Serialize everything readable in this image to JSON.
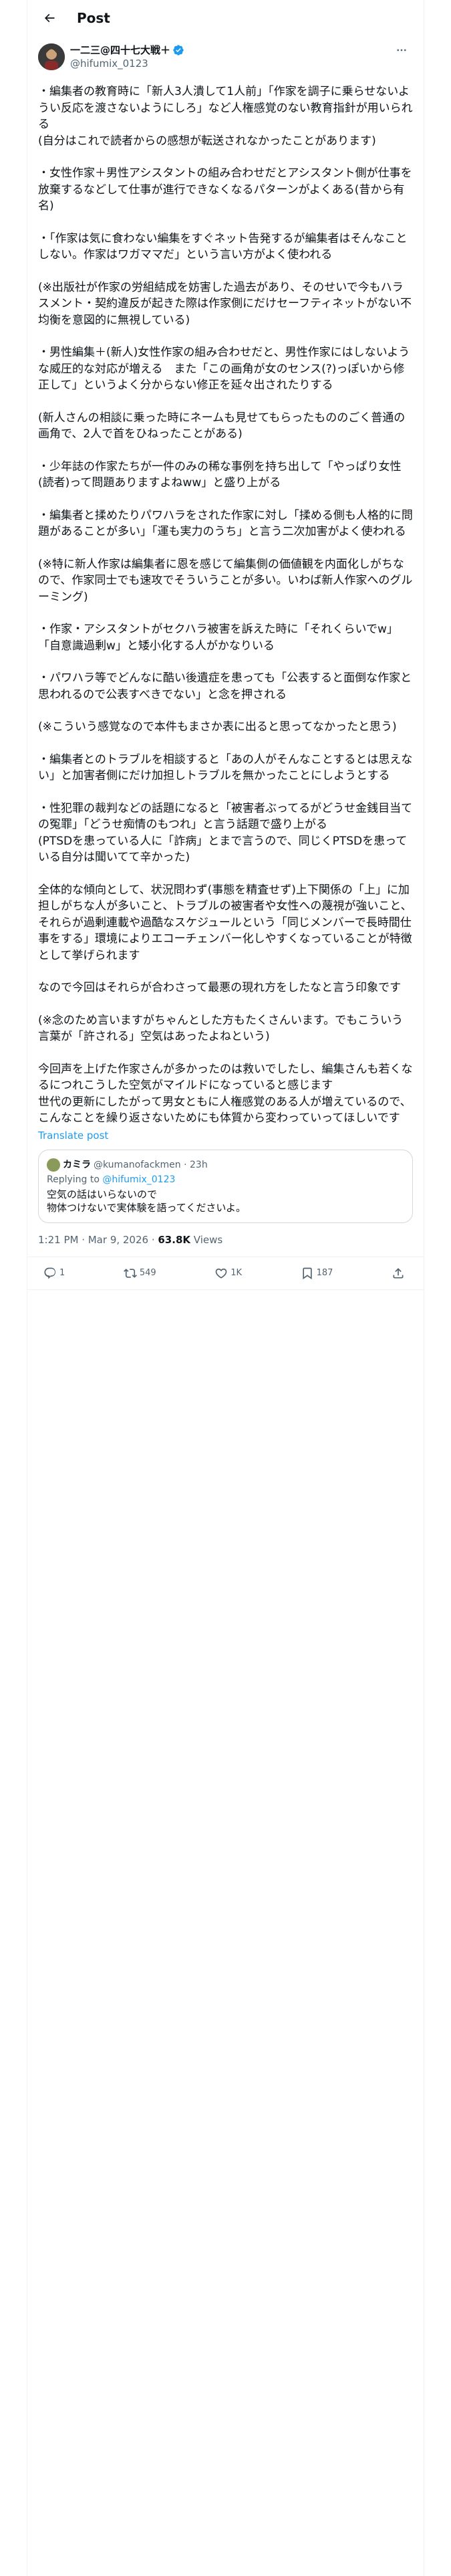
{
  "header": {
    "title": "Post"
  },
  "author": {
    "display_name": "一二三@四十七大戦＋",
    "handle": "@hifumix_0123"
  },
  "post": {
    "paragraphs": [
      "・編集者の教育時に「新人3人潰して1人前」「作家を調子に乗らせないようい反応を渡さないようにしろ」など人権感覚のない教育指針が用いられる\n(自分はこれで読者からの感想が転送されなかったことがあります)",
      "・女性作家＋男性アシスタントの組み合わせだとアシスタント側が仕事を放棄するなどして仕事が進行できなくなるパターンがよくある(昔から有名)",
      "・「作家は気に食わない編集をすぐネット告発するが編集者はそんなことしない。作家はワガママだ」という言い方がよく使われる",
      "(※出版社が作家の労組結成を妨害した過去があり、そのせいで今もハラスメント・契約違反が起きた際は作家側にだけセーフティネットがない不均衡を意図的に無視している)",
      "・男性編集＋(新人)女性作家の組み合わせだと、男性作家にはしないような威圧的な対応が増える　また「この画角が女のセンス(?)っぽいから修正して」というよく分からない修正を延々出されたりする",
      "(新人さんの相談に乗った時にネームも見せてもらったもののごく普通の画角で、2人で首をひねったことがある)",
      "・少年誌の作家たちが一件のみの稀な事例を持ち出して「やっぱり女性(読者)って問題ありますよねww」と盛り上がる",
      "・編集者と揉めたりパワハラをされた作家に対し「揉める側も人格的に問題があることが多い」「運も実力のうち」と言う二次加害がよく使われる",
      "(※特に新人作家は編集者に恩を感じて編集側の価値観を内面化しがちなので、作家同士でも速攻でそういうことが多い。いわば新人作家へのグルーミング)",
      "・作家・アシスタントがセクハラ被害を訴えた時に「それくらいでw」「自意識過剰w」と矮小化する人がかなりいる",
      "・パワハラ等でどんなに酷い後遺症を患っても「公表すると面倒な作家と思われるので公表すべきでない」と念を押される",
      "(※こういう感覚なので本件もまさか表に出ると思ってなかったと思う)",
      "・編集者とのトラブルを相談すると「あの人がそんなことするとは思えない」と加害者側にだけ加担しトラブルを無かったことにしようとする",
      "・性犯罪の裁判などの話題になると「被害者ぶってるがどうせ金銭目当ての冤罪」「どうせ痴情のもつれ」と言う話題で盛り上がる\n(PTSDを患っている人に「詐病」とまで言うので、同じくPTSDを患っている自分は聞いてて辛かった)",
      "全体的な傾向として、状況問わず(事態を精査せず)上下関係の「上」に加担しがちな人が多いこと、トラブルの被害者や女性への蔑視が強いこと、それらが過剰連載や過酷なスケジュールという「同じメンバーで長時間仕事をする」環境によりエコーチェンバー化しやすくなっていることが特徴として挙げられます",
      "なので今回はそれらが合わさって最悪の現れ方をしたなと言う印象です",
      "(※念のため言いますがちゃんとした方もたくさんいます。でもこういう言葉が「許される」空気はあったよねという)",
      "今回声を上げた作家さんが多かったのは救いでしたし、編集さんも若くなるにつれこうした空気がマイルドになっていると感じます\n世代の更新にしたがって男女ともに人権感覚のある人が増えているので、こんなことを繰り返さないためにも体質から変わっていってほしいです"
    ],
    "translate_label": "Translate post"
  },
  "quote": {
    "display_name": "カミラ",
    "handle": "@kumanofackmen",
    "time": "23h",
    "replying_to_label": "Replying to ",
    "replying_to_handle": "@hifumix_0123",
    "text": "空気の話はいらないので\n物体つけないで実体験を語ってくださいよ。"
  },
  "meta": {
    "timestamp": "1:21 PM · Mar 9, 2026 · ",
    "views_count": "63.8K",
    "views_label": " Views"
  },
  "actions": {
    "replies": "1",
    "reposts": "549",
    "likes": "1K",
    "bookmarks": "187"
  }
}
